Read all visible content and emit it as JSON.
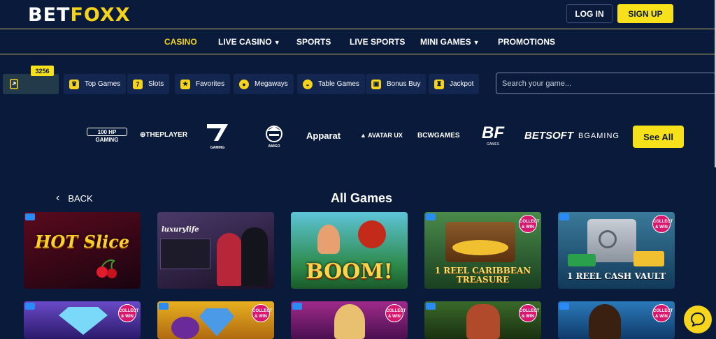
{
  "header": {
    "logo_part1": "BET",
    "logo_part2": "FOXX",
    "login_label": "LOG IN",
    "signup_label": "SIGN UP"
  },
  "nav": {
    "items": [
      {
        "label": "CASINO",
        "active": true
      },
      {
        "label": "LIVE CASINO",
        "dropdown": true
      },
      {
        "label": "SPORTS"
      },
      {
        "label": "LIVE SPORTS"
      },
      {
        "label": "MINI GAMES",
        "dropdown": true
      },
      {
        "label": "PROMOTIONS"
      }
    ]
  },
  "categories": {
    "count": "3256",
    "items": [
      {
        "label": "Top Games",
        "icon": "trophy-icon"
      },
      {
        "label": "Slots",
        "icon": "slot-icon"
      },
      {
        "label": "Favorites",
        "icon": "star-icon"
      },
      {
        "label": "Megaways",
        "icon": "megaways-icon"
      },
      {
        "label": "Table Games",
        "icon": "table-games-icon"
      },
      {
        "label": "Bonus Buy",
        "icon": "gift-icon"
      },
      {
        "label": "Jackpot",
        "icon": "jackpot-icon"
      }
    ]
  },
  "search": {
    "placeholder": "Search your game..."
  },
  "providers": {
    "items": [
      {
        "label": "100 HP GAMING"
      },
      {
        "label": "THEPLAYER"
      },
      {
        "label": "GAMING"
      },
      {
        "label": "AMIGO"
      },
      {
        "label": "Apparat"
      },
      {
        "label": "AVATAR UX"
      },
      {
        "label": "BCWGAMES"
      },
      {
        "label": "GAMES"
      },
      {
        "label": "BETSOFT"
      },
      {
        "label": "BGAMING"
      }
    ],
    "see_all_label": "See All"
  },
  "games_section": {
    "back_label": "BACK",
    "title": "All Games",
    "row1": [
      {
        "name": "HOT Slice",
        "bg": "#2a0a18"
      },
      {
        "name": "luxurylife",
        "bg": "#3a2a4a"
      },
      {
        "name": "BOOM!",
        "bg": "#2d8a4a"
      },
      {
        "name": "1 REEL CARIBBEAN TREASURE",
        "bg": "#2a5a30"
      },
      {
        "name": "1 REEL CASH VAULT",
        "bg": "#2a5a7a"
      }
    ],
    "collect_badge": "COLLECT & WIN"
  },
  "colors": {
    "background": "#0a1a3a",
    "accent": "#f7e11b"
  }
}
